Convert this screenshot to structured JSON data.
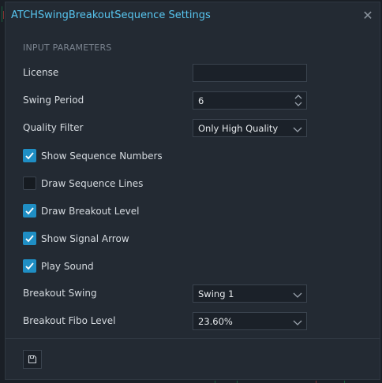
{
  "dialog": {
    "title": "ATCHSwingBreakoutSequence Settings",
    "close_icon": "close-icon"
  },
  "section": {
    "label": "INPUT PARAMETERS"
  },
  "fields": {
    "license": {
      "label": "License",
      "value": ""
    },
    "swing_period": {
      "label": "Swing Period",
      "value": "6"
    },
    "quality_filter": {
      "label": "Quality Filter",
      "value": "Only High Quality"
    },
    "breakout_swing": {
      "label": "Breakout Swing",
      "value": "Swing 1"
    },
    "breakout_fibo_level": {
      "label": "Breakout Fibo Level",
      "value": "23.60%"
    }
  },
  "checkboxes": {
    "show_sequence_numbers": {
      "label": "Show Sequence Numbers",
      "checked": true
    },
    "draw_sequence_lines": {
      "label": "Draw Sequence Lines",
      "checked": false
    },
    "draw_breakout_level": {
      "label": "Draw Breakout Level",
      "checked": true
    },
    "show_signal_arrow": {
      "label": "Show Signal Arrow",
      "checked": true
    },
    "play_sound": {
      "label": "Play Sound",
      "checked": true
    }
  },
  "footer": {
    "save_icon": "save-icon"
  },
  "colors": {
    "accent": "#1f8ec4",
    "title": "#58c6f0",
    "background": "#232a33"
  }
}
